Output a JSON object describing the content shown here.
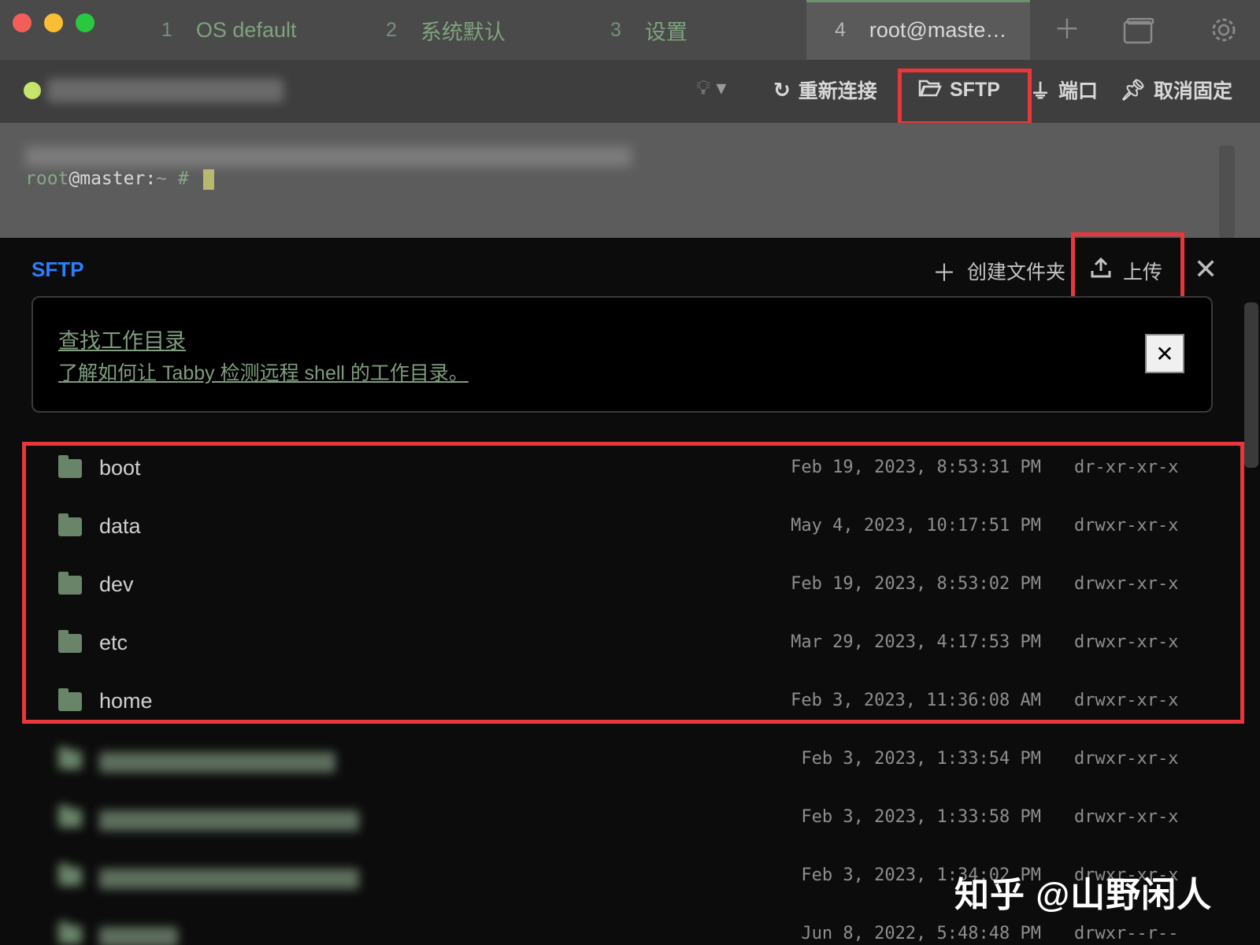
{
  "tabs": [
    {
      "num": "1",
      "label": "OS default"
    },
    {
      "num": "2",
      "label": "系统默认"
    },
    {
      "num": "3",
      "label": "设置"
    },
    {
      "num": "4",
      "label": "root@maste…"
    }
  ],
  "titlebar_icons": {
    "new_tab": "plus-icon",
    "window": "window-icon",
    "settings": "gear-icon"
  },
  "toolbar": {
    "reconnect_label": "重新连接",
    "sftp_label": "SFTP",
    "ports_label": "端口",
    "unpin_label": "取消固定"
  },
  "terminal": {
    "prompt_user": "root",
    "prompt_host": "@master:",
    "prompt_path": "~",
    "prompt_symbol": "#"
  },
  "sftp": {
    "title": "SFTP",
    "create_folder_label": "创建文件夹",
    "upload_label": "上传",
    "notice_title": "查找工作目录",
    "notice_link": "了解如何让 Tabby 检测远程 shell 的工作目录。",
    "notice_close": "✕",
    "files": [
      {
        "name": "boot",
        "date": "Feb 19, 2023, 8:53:31 PM",
        "perm": "dr-xr-xr-x"
      },
      {
        "name": "data",
        "date": "May 4, 2023, 10:17:51 PM",
        "perm": "drwxr-xr-x"
      },
      {
        "name": "dev",
        "date": "Feb 19, 2023, 8:53:02 PM",
        "perm": "drwxr-xr-x"
      },
      {
        "name": "etc",
        "date": "Mar 29, 2023, 4:17:53 PM",
        "perm": "drwxr-xr-x"
      },
      {
        "name": "home",
        "date": "Feb 3, 2023, 11:36:08 AM",
        "perm": "drwxr-xr-x"
      },
      {
        "name": "",
        "date": "Feb 3, 2023, 1:33:54 PM",
        "perm": "drwxr-xr-x"
      },
      {
        "name": "",
        "date": "Feb 3, 2023, 1:33:58 PM",
        "perm": "drwxr-xr-x"
      },
      {
        "name": "",
        "date": "Feb 3, 2023, 1:34:02 PM",
        "perm": "drwxr-xr-x"
      },
      {
        "name": "",
        "date": "Jun 8, 2022, 5:48:48 PM",
        "perm": "drwxr--r--"
      }
    ]
  },
  "watermark": "知乎 @山野闲人",
  "colors": {
    "highlight": "#e8363b",
    "sftp_title": "#2a7fff",
    "status_dot": "#c7e56b"
  }
}
